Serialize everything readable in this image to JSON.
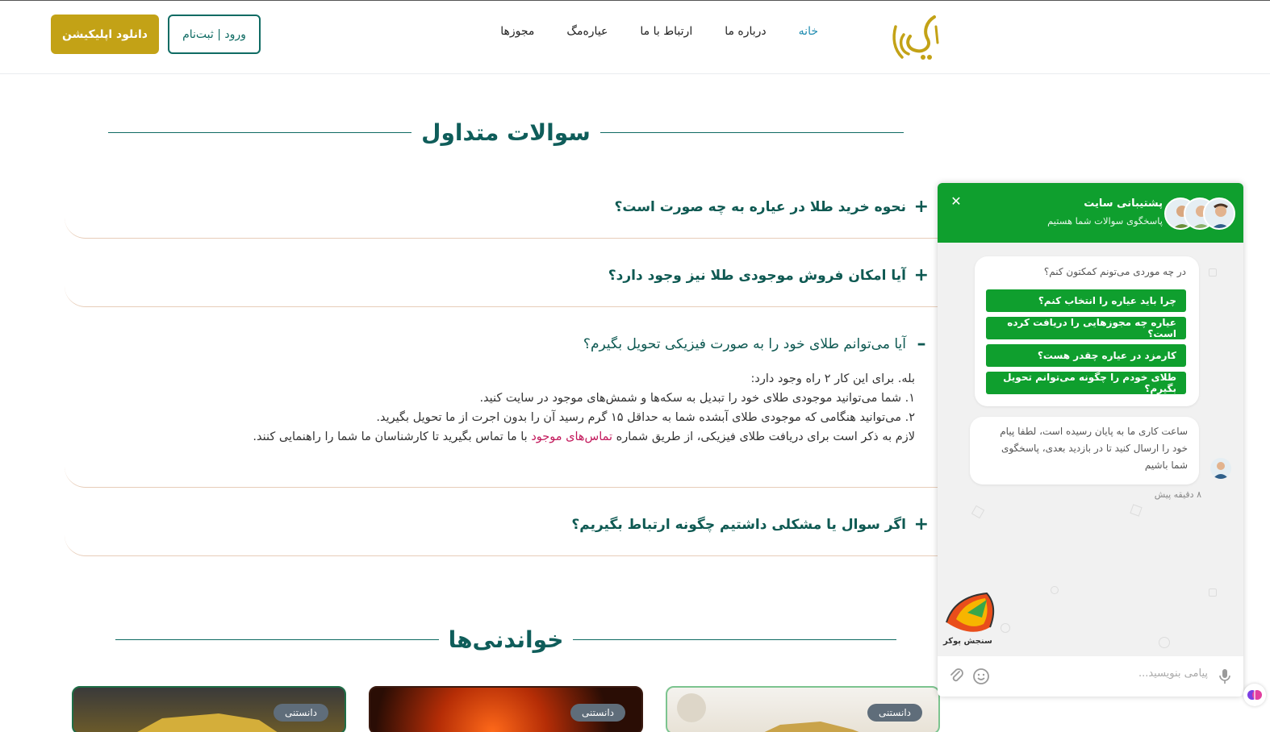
{
  "header": {
    "logo_alt": "عیار",
    "nav": [
      {
        "label": "خانه",
        "active": true
      },
      {
        "label": "درباره ما",
        "active": false
      },
      {
        "label": "ارتباط با ما",
        "active": false
      },
      {
        "label": "عیاره‌مگ",
        "active": false
      },
      {
        "label": "مجوزها",
        "active": false
      }
    ],
    "login_label": "ورود | ثبت‌نام",
    "download_label": "دانلود اپلیکیشن"
  },
  "faq": {
    "title": "سوالات متداول",
    "items": [
      {
        "question": "نحوه خرید طلا در عیاره به چه صورت است؟",
        "open": false
      },
      {
        "question": "آیا امکان فروش موجودی طلا نیز وجود دارد؟",
        "open": false
      },
      {
        "question": "آیا می‌توانم طلای خود را به صورت فیزیکی تحویل بگیرم؟",
        "open": true
      },
      {
        "question": "اگر سوال یا مشکلی داشتیم چگونه ارتباط بگیریم؟",
        "open": false
      }
    ],
    "answer": {
      "line1": "بله. برای این کار ۲ راه وجود دارد:",
      "line2": "۱. شما می‌توانید موجودی طلای خود را تبدیل به سکه‌ها و شمش‌های موجود در سایت کنید.",
      "line3": "۲. می‌توانید هنگامی که موجودی طلای آبشده شما به حداقل ۱۵ گرم رسید آن را بدون اجرت از ما تحویل بگیرید.",
      "line4_before": "لازم به ذکر است برای دریافت طلای فیزیکی، از طریق شماره ",
      "line4_link": "تماس‌های موجود",
      "line4_after": " با ما تماس بگیرید تا کارشناسان ما شما را راهنمایی کنند."
    }
  },
  "readings": {
    "title": "خواندنی‌ها",
    "cards": [
      {
        "badge": "دانستنی"
      },
      {
        "badge": "دانستنی"
      },
      {
        "badge": "دانستنی"
      }
    ]
  },
  "chat": {
    "title": "پشتیبانی سایت",
    "subtitle": "پاسخگوی سوالات شما هستیم",
    "close": "✕",
    "ask": "در چه موردی می‌تونم کمکتون کنم؟",
    "quick_replies": [
      "چرا باید عیاره را انتخاب کنم؟",
      "عیاره چه مجوزهایی را دریافت کرده است؟",
      "کارمزد در عیاره چقدر هست؟",
      "طلای خودم را چگونه می‌توانم تحویل بگیرم؟"
    ],
    "offline_message": "ساعت کاری ما به پایان رسیده است، لطفا پیام خود را ارسال کنید تا در بازدید بعدی، پاسخگوی شما باشیم",
    "time": "۸ دقیقه پیش",
    "input_placeholder": "پیامی بنویسید...",
    "brand_label": "سنجش پوکر",
    "colors": {
      "primary": "#0f9f2e"
    }
  }
}
